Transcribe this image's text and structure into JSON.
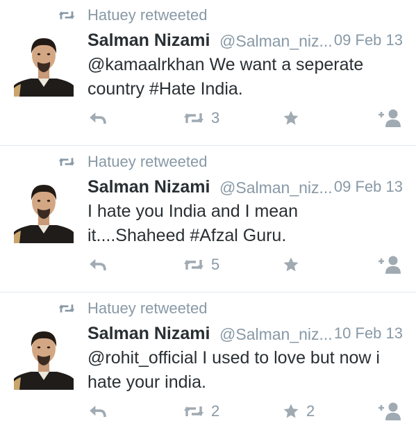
{
  "colors": {
    "icon_gray": "#a0aab2",
    "text_gray": "#8899a6",
    "text_dark": "#292f33",
    "divider": "#e1e8ed"
  },
  "tweets": [
    {
      "retweet_label": "Hatuey retweeted",
      "name": "Salman Nizami",
      "handle": "@Salman_niz...",
      "date": "09 Feb 13",
      "text_line1": "@kamaalrkhan We want a seperate",
      "text_line2": "country #Hate India.",
      "retweets": "3",
      "favorites": ""
    },
    {
      "retweet_label": "Hatuey retweeted",
      "name": "Salman Nizami",
      "handle": "@Salman_niz...",
      "date": "09 Feb 13",
      "text_line1": "I hate you India and I mean",
      "text_line2": "it....Shaheed #Afzal Guru.",
      "retweets": "5",
      "favorites": ""
    },
    {
      "retweet_label": "Hatuey retweeted",
      "name": "Salman Nizami",
      "handle": "@Salman_niz...",
      "date": "10 Feb 13",
      "text_line1": "@rohit_official I used to love but now i",
      "text_line2": "hate your india.",
      "retweets": "2",
      "favorites": "2"
    }
  ],
  "icons": [
    "retweet-icon",
    "avatar",
    "reply-icon",
    "star-icon",
    "follow-icon"
  ]
}
